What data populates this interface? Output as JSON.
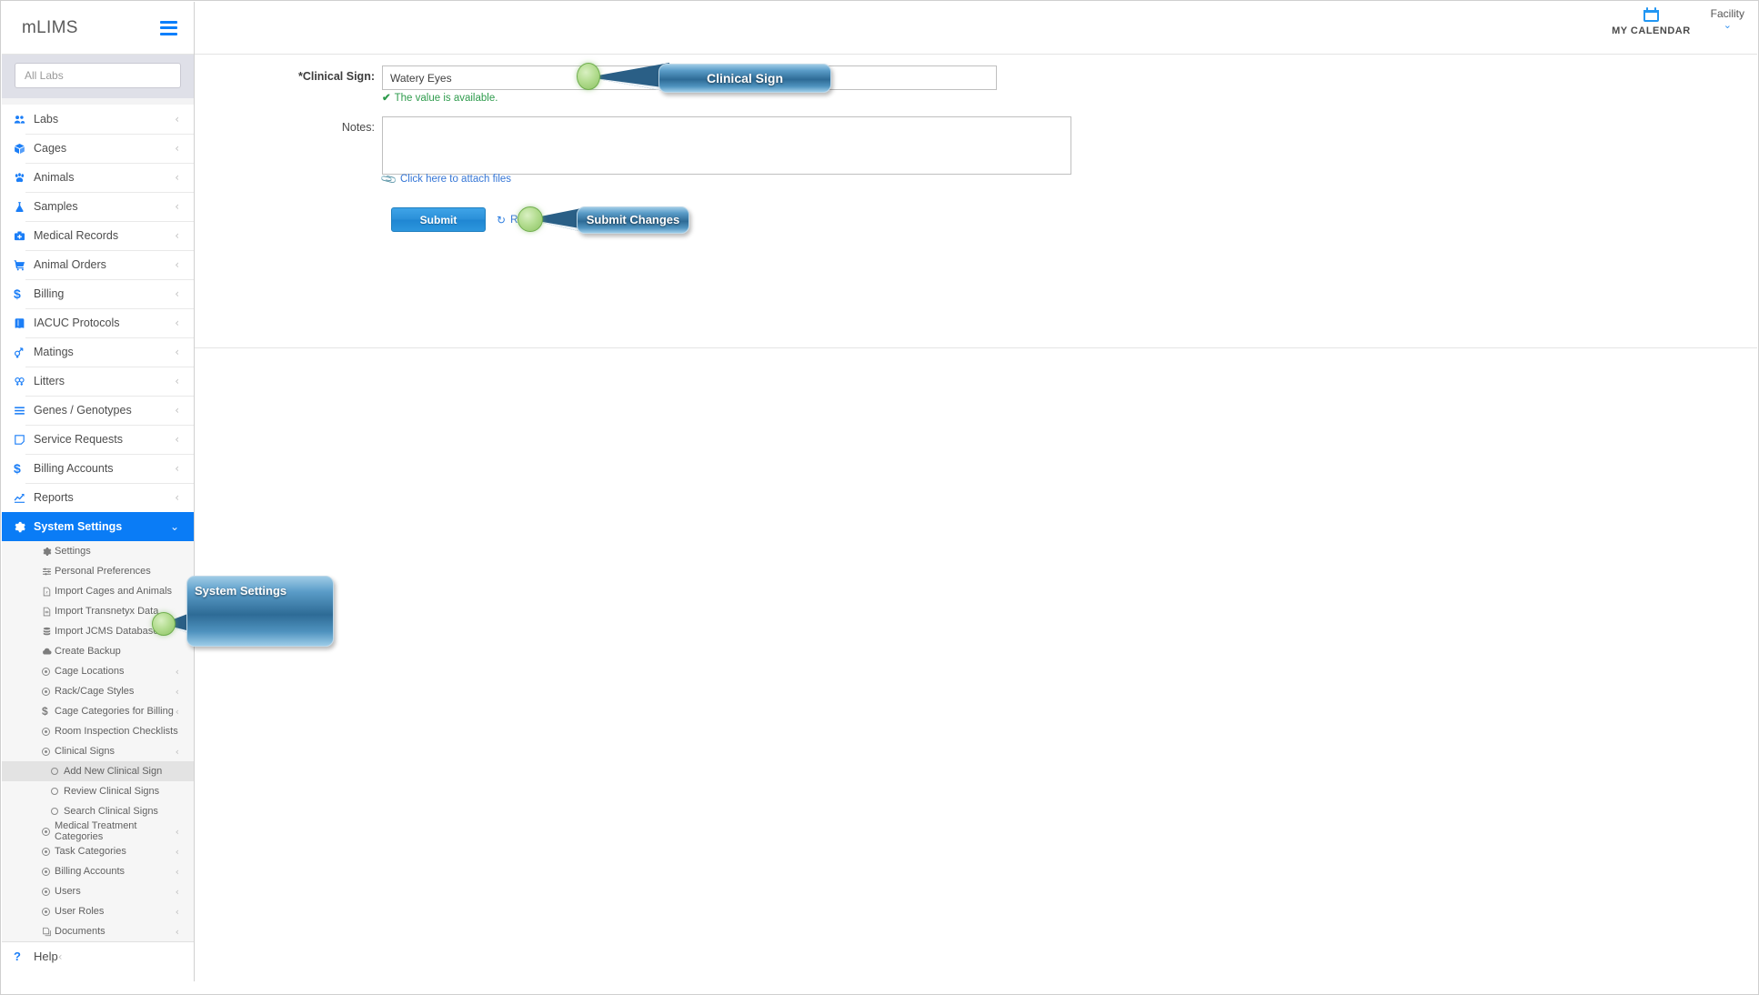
{
  "app": {
    "brand": "mLIMS",
    "menu_icon": "hamburger-icon"
  },
  "header": {
    "calendar_label": "MY CALENDAR",
    "calendar_icon": "calendar-icon",
    "facility_label": "Facility",
    "facility_chevron": "⌄"
  },
  "sidebar": {
    "search_placeholder": "All Labs",
    "search_value": "",
    "items": [
      {
        "label": "Labs",
        "icon": "users-icon",
        "chevron": "‹"
      },
      {
        "label": "Cages",
        "icon": "box-icon",
        "chevron": "‹"
      },
      {
        "label": "Animals",
        "icon": "paw-icon",
        "chevron": "‹"
      },
      {
        "label": "Samples",
        "icon": "flask-icon",
        "chevron": "‹"
      },
      {
        "label": "Medical Records",
        "icon": "medkit-icon",
        "chevron": "‹"
      },
      {
        "label": "Animal Orders",
        "icon": "cart-icon",
        "chevron": "‹"
      },
      {
        "label": "Billing",
        "icon": "dollar-icon",
        "chevron": "‹"
      },
      {
        "label": "IACUC Protocols",
        "icon": "book-icon",
        "chevron": "‹"
      },
      {
        "label": "Matings",
        "icon": "mating-icon",
        "chevron": "‹"
      },
      {
        "label": "Litters",
        "icon": "litters-icon",
        "chevron": "‹"
      },
      {
        "label": "Genes / Genotypes",
        "icon": "list-icon",
        "chevron": "‹"
      },
      {
        "label": "Service Requests",
        "icon": "note-icon",
        "chevron": "‹"
      },
      {
        "label": "Billing Accounts",
        "icon": "dollar-icon",
        "chevron": "‹"
      },
      {
        "label": "Reports",
        "icon": "chart-icon",
        "chevron": "‹"
      }
    ],
    "system_settings": {
      "label": "System Settings",
      "icon": "gear-icon",
      "chevron": "⌄"
    },
    "sub_items": [
      {
        "label": "Settings",
        "icon": "gear-icon",
        "chevron": ""
      },
      {
        "label": "Personal Preferences",
        "icon": "sliders-icon",
        "chevron": ""
      },
      {
        "label": "Import Cages and Animals",
        "icon": "file-excel-icon",
        "chevron": ""
      },
      {
        "label": "Import Transnetyx Data",
        "icon": "file-icon",
        "chevron": ""
      },
      {
        "label": "Import JCMS Database",
        "icon": "database-icon",
        "chevron": ""
      },
      {
        "label": "Create Backup",
        "icon": "cloud-icon",
        "chevron": ""
      },
      {
        "label": "Cage Locations",
        "icon": "dot-circle-icon",
        "chevron": "‹"
      },
      {
        "label": "Rack/Cage Styles",
        "icon": "dot-circle-icon",
        "chevron": "‹"
      },
      {
        "label": "Cage Categories for Billing",
        "icon": "dollar-icon",
        "chevron": "‹"
      },
      {
        "label": "Room Inspection Checklists",
        "icon": "dot-circle-icon",
        "chevron": ""
      },
      {
        "label": "Clinical Signs",
        "icon": "dot-circle-icon",
        "chevron": "‹"
      }
    ],
    "clinical_sign_children": [
      {
        "label": "Add New Clinical Sign",
        "icon": "circle-icon",
        "selected": true
      },
      {
        "label": "Review Clinical Signs",
        "icon": "circle-icon",
        "selected": false
      },
      {
        "label": "Search Clinical Signs",
        "icon": "circle-icon",
        "selected": false
      }
    ],
    "sub_items_after": [
      {
        "label": "Medical Treatment Categories",
        "icon": "dot-circle-icon",
        "chevron": "‹"
      },
      {
        "label": "Task Categories",
        "icon": "dot-circle-icon",
        "chevron": "‹"
      },
      {
        "label": "Billing Accounts",
        "icon": "dot-circle-icon",
        "chevron": "‹"
      },
      {
        "label": "Users",
        "icon": "dot-circle-icon",
        "chevron": "‹"
      },
      {
        "label": "User Roles",
        "icon": "dot-circle-icon",
        "chevron": "‹"
      },
      {
        "label": "Documents",
        "icon": "copy-icon",
        "chevron": "‹"
      }
    ],
    "help": {
      "label": "Help",
      "icon": "question-icon",
      "chevron": "‹"
    }
  },
  "form": {
    "clinical_sign_label": "*Clinical Sign:",
    "clinical_sign_value": "Watery Eyes",
    "clinical_sign_placeholder": "",
    "availability_check": "✔",
    "availability_message": "The value is available.",
    "notes_label": "Notes:",
    "notes_value": "",
    "notes_placeholder": "",
    "attach_icon": "paperclip-icon",
    "attach_label": "Click here to attach files",
    "submit_label": "Submit",
    "reset_icon": "refresh-icon",
    "reset_label": "Reset"
  },
  "callouts": [
    {
      "text": "Clinical Sign"
    },
    {
      "text": "Submit Changes"
    },
    {
      "text": "System Settings"
    }
  ],
  "colors": {
    "accent": "#0a7cf6",
    "submit_button": "#2a8fd8",
    "success": "#2e9b4c",
    "link": "#3576d6",
    "callout_blue": "#2e6b96",
    "bubble_green": "#b4dd91"
  }
}
